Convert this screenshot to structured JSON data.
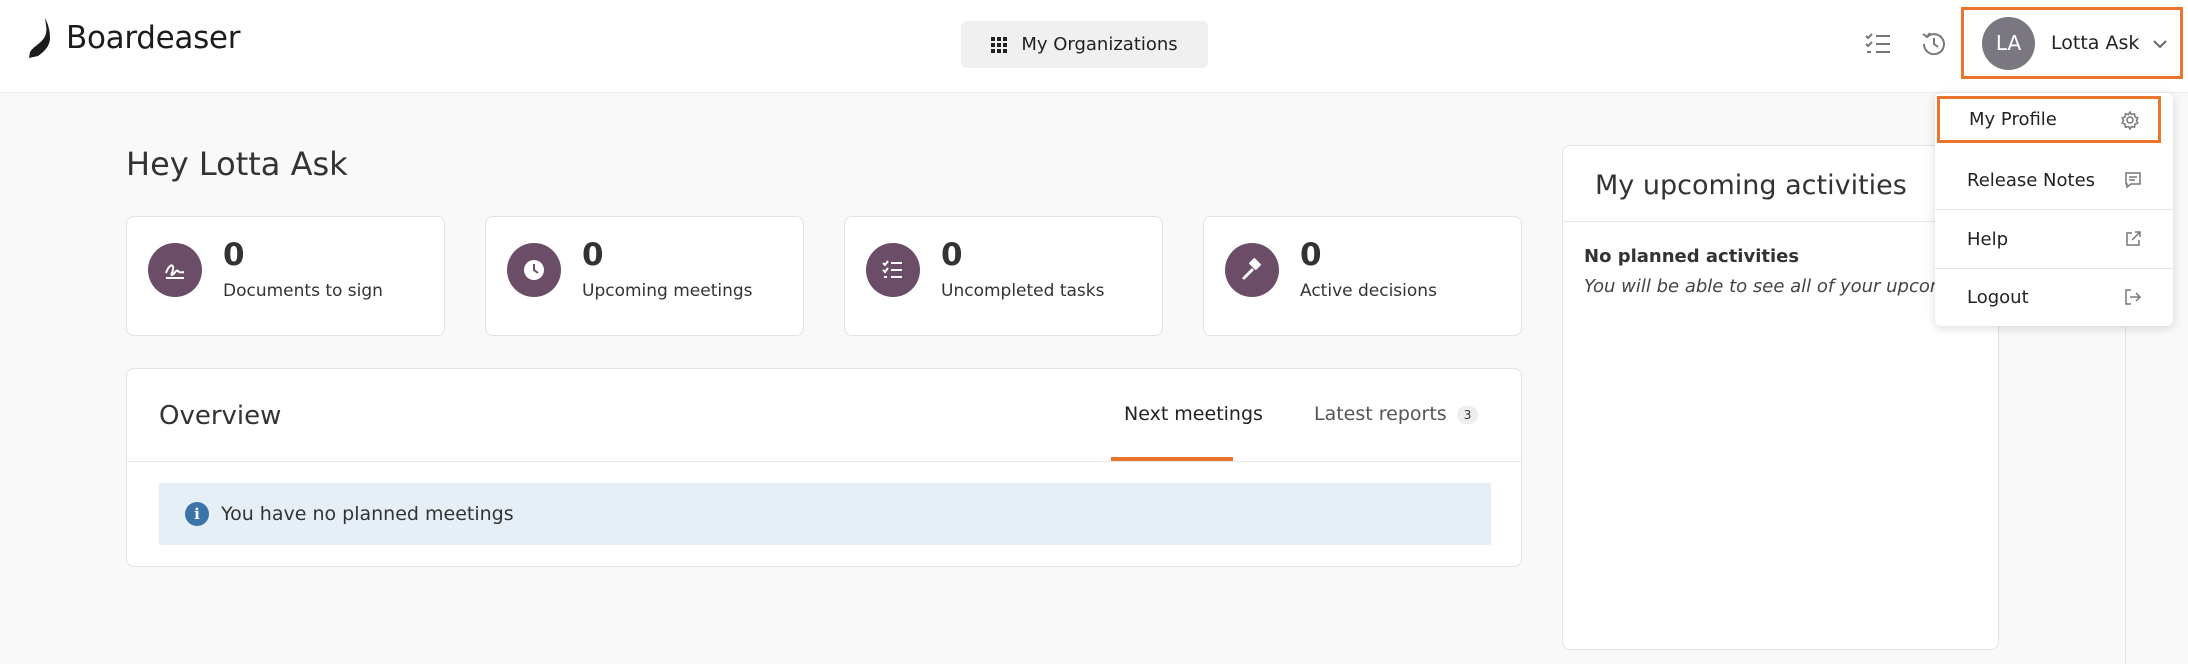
{
  "header": {
    "logo_text": "Boardeaser",
    "org_button_label": "My Organizations",
    "user": {
      "initials": "LA",
      "name": "Lotta Ask"
    }
  },
  "main": {
    "greeting": "Hey Lotta Ask",
    "stats": [
      {
        "value": "0",
        "label": "Documents to sign",
        "icon": "signature-icon"
      },
      {
        "value": "0",
        "label": "Upcoming meetings",
        "icon": "clock-icon"
      },
      {
        "value": "0",
        "label": "Uncompleted tasks",
        "icon": "checklist-icon"
      },
      {
        "value": "0",
        "label": "Active decisions",
        "icon": "gavel-icon"
      }
    ],
    "overview": {
      "title": "Overview",
      "tabs": [
        {
          "label": "Next meetings",
          "active": true
        },
        {
          "label": "Latest reports",
          "badge": "3"
        }
      ],
      "info_message": "You have no planned meetings"
    }
  },
  "activities": {
    "title": "My upcoming activities",
    "empty_title": "No planned activities",
    "empty_text": "You will be able to see all of your upcoming activities here."
  },
  "dropdown": {
    "items": [
      {
        "label": "My Profile",
        "icon": "gear-icon"
      },
      {
        "label": "Release Notes",
        "icon": "message-icon"
      },
      {
        "label": "Help",
        "icon": "external-link-icon"
      },
      {
        "label": "Logout",
        "icon": "logout-icon"
      }
    ]
  },
  "colors": {
    "accent": "#e9742b",
    "icon_circle": "#6b4d67",
    "info_bg": "#e7eff6",
    "info_icon": "#3b74a8"
  }
}
